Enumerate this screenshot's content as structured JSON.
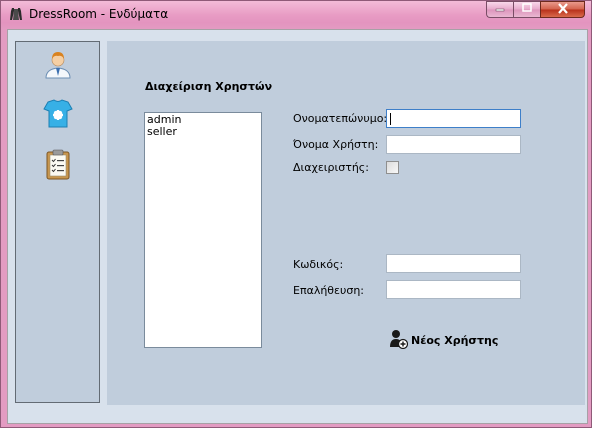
{
  "window": {
    "title": "DressRoom - Ενδύματα",
    "controls": {
      "minimize": "minimize",
      "maximize": "maximize",
      "close": "close"
    }
  },
  "sidebar": {
    "items": [
      {
        "icon": "user-icon"
      },
      {
        "icon": "tshirt-icon"
      },
      {
        "icon": "clipboard-icon"
      }
    ]
  },
  "main": {
    "section_title": "Διαχείριση Χρηστών",
    "users": [
      "admin",
      "seller"
    ],
    "form": {
      "fullname_label": "Ονοματεπώνυμο:",
      "fullname_value": "",
      "username_label": "Όνομα Χρήστη:",
      "username_value": "",
      "admin_label": "Διαχειριστής:",
      "admin_checked": false,
      "password_label": "Κωδικός:",
      "password_value": "",
      "confirm_label": "Επαλήθευση:",
      "confirm_value": ""
    },
    "new_user_button": "Νέος Χρήστης"
  },
  "colors": {
    "titlebar": "#e39bc2",
    "panel": "#c0cddc",
    "client": "#d8e1ec",
    "close": "#c8402a"
  }
}
